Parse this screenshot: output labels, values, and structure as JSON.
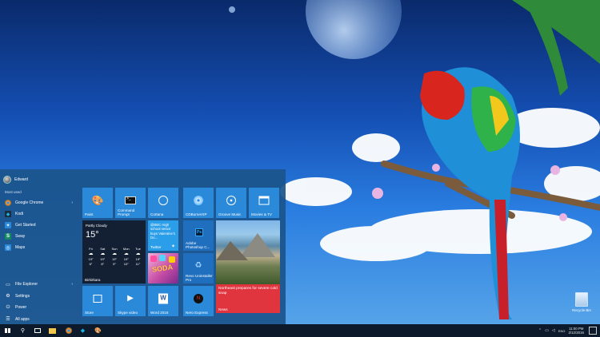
{
  "desktop": {
    "recycle_bin_label": "Recycle Bin"
  },
  "start_menu": {
    "user_name": "Edward",
    "most_used_label": "Most used",
    "apps": [
      {
        "label": "Google Chrome",
        "icon": "chrome-icon",
        "has_submenu": true
      },
      {
        "label": "Kodi",
        "icon": "kodi-icon",
        "has_submenu": false
      },
      {
        "label": "Get Started",
        "icon": "lightbulb-icon",
        "has_submenu": false
      },
      {
        "label": "Sway",
        "icon": "sway-icon",
        "has_submenu": false
      },
      {
        "label": "Maps",
        "icon": "maps-icon",
        "has_submenu": false
      }
    ],
    "system": [
      {
        "label": "File Explorer",
        "icon": "folder-icon",
        "has_submenu": true
      },
      {
        "label": "Settings",
        "icon": "gear-icon"
      },
      {
        "label": "Power",
        "icon": "power-icon"
      },
      {
        "label": "All apps",
        "icon": "list-icon"
      }
    ],
    "tiles": {
      "paint": "Paint",
      "cmd": "Command Prompt",
      "cortana": "Cortana",
      "cdburner": "CDBurnerXP",
      "groove": "Groove Music",
      "movies": "Movies & TV",
      "weather": {
        "condition": "Partly Cloudy",
        "temperature": "15°",
        "days": [
          {
            "day": "Fri",
            "high": "19°",
            "low": "6°"
          },
          {
            "day": "Sat",
            "high": "19°",
            "low": "8°"
          },
          {
            "day": "Sun",
            "high": "19°",
            "low": "9°"
          },
          {
            "day": "Mon",
            "high": "19°",
            "low": "10°"
          },
          {
            "day": "Tue",
            "high": "19°",
            "low": "11°"
          }
        ],
        "location": "Birkirkara"
      },
      "twitter": {
        "text": "@BBC High school senior buys Valentine's Do...",
        "label": "Twitter"
      },
      "photoshop": "Adobe Photoshop C...",
      "revo": "Revo Uninstaller Pro",
      "candy_text": "SODA",
      "store": "Store",
      "skype": "Skype video",
      "word": "Word 2016",
      "nero": "Nero Express",
      "news": {
        "headline": "Northeast prepares for severe cold snap",
        "label": "News"
      }
    }
  },
  "taskbar": {
    "time": "11:00 PM",
    "date": "2/12/2016",
    "tray_language": "ENG"
  },
  "colors": {
    "start_bg": "#1c548c",
    "tile_blue": "#2b89d9",
    "news_red": "#e0343f",
    "taskbar": "#0c1a2c"
  }
}
